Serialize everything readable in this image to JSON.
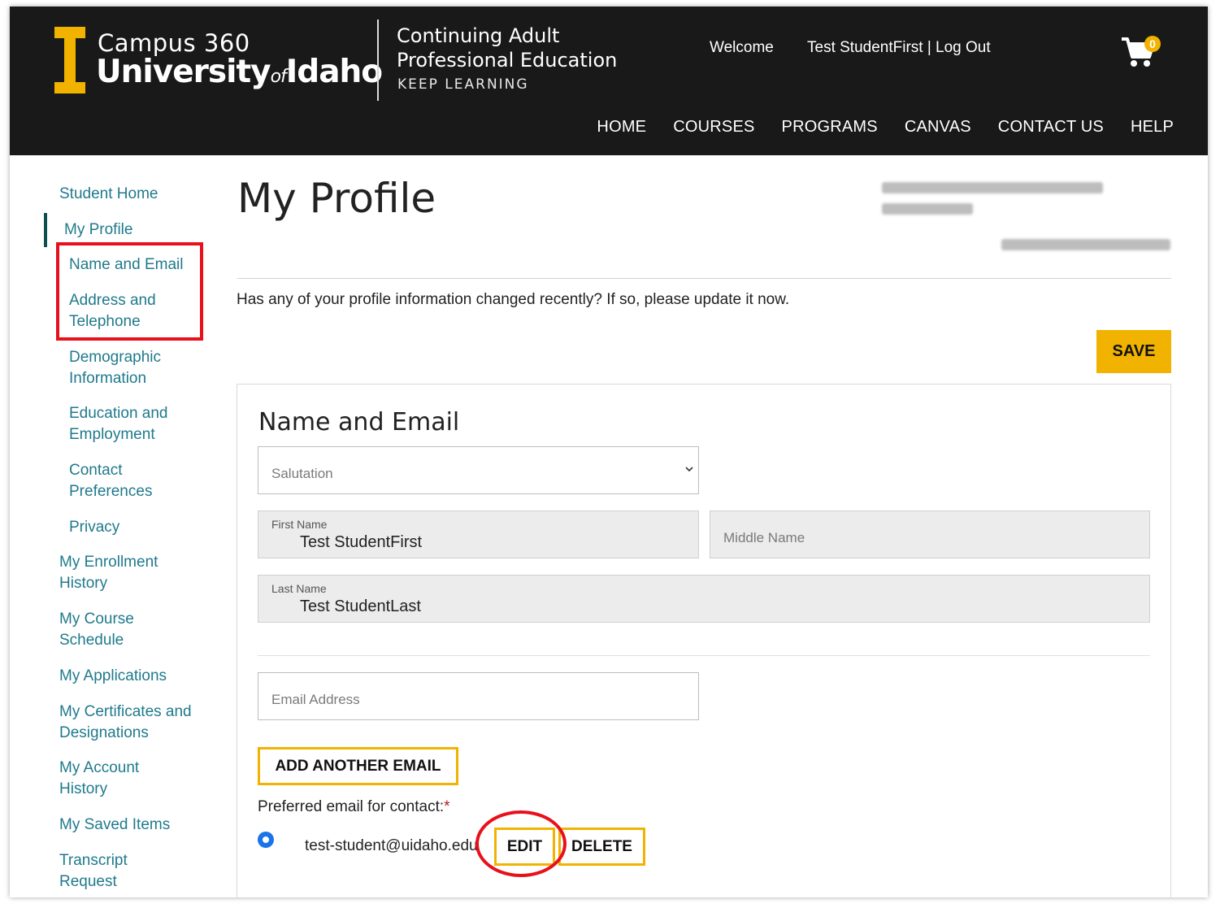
{
  "header": {
    "logo_line1": "Campus 360",
    "logo_line2_a": "University",
    "logo_line2_of": "of",
    "logo_line2_b": "Idaho",
    "cape_line1": "Continuing Adult",
    "cape_line2": "Professional Education",
    "cape_line3": "KEEP LEARNING",
    "welcome": "Welcome",
    "user": "Test StudentFirst | Log Out",
    "cart_count": "0",
    "nav": [
      "HOME",
      "COURSES",
      "PROGRAMS",
      "CANVAS",
      "CONTACT US",
      "HELP"
    ]
  },
  "sidebar": {
    "items": [
      "Student Home",
      "My Profile",
      "Name and Email",
      "Address and Telephone",
      "Demographic Information",
      "Education and Employment",
      "Contact Preferences",
      "Privacy",
      "My Enrollment History",
      "My Course Schedule",
      "My Applications",
      "My Certificates and Designations",
      "My Account History",
      "My Saved Items",
      "Transcript Request"
    ]
  },
  "main": {
    "title": "My Profile",
    "intro": "Has any of your profile information changed recently? If so, please update it now.",
    "save_label": "SAVE",
    "section_title": "Name and Email",
    "salutation_placeholder": "Salutation",
    "first_name_label": "First Name",
    "first_name_value": "Test StudentFirst",
    "middle_name_placeholder": "Middle Name",
    "last_name_label": "Last Name",
    "last_name_value": "Test StudentLast",
    "email_placeholder": "Email Address",
    "add_email_label": "ADD ANOTHER EMAIL",
    "preferred_label": "Preferred email for contact:",
    "required_mark": "*",
    "email_value": "test-student@uidaho.edu",
    "edit_label": "EDIT",
    "delete_label": "DELETE"
  },
  "colors": {
    "header_bg": "#191919",
    "accent": "#f1b300",
    "link": "#1f7a8c",
    "annotation": "#e8101a"
  }
}
